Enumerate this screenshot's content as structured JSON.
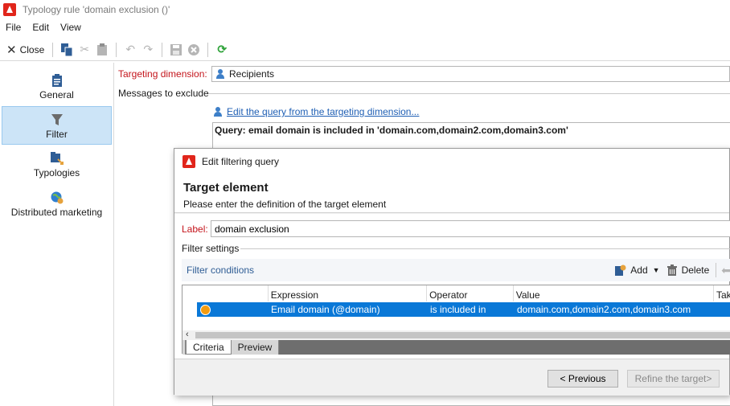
{
  "window": {
    "title": "Typology rule 'domain exclusion ()'"
  },
  "menu": {
    "file": "File",
    "edit": "Edit",
    "view": "View"
  },
  "toolbar": {
    "close_label": "Close",
    "icons": [
      "copy-icon",
      "cut-icon",
      "paste-icon",
      "undo-icon",
      "redo-icon",
      "save-icon",
      "cancel-icon",
      "refresh-icon"
    ]
  },
  "sidebar": {
    "items": [
      {
        "label": "General",
        "icon": "general-icon"
      },
      {
        "label": "Filter",
        "icon": "filter-icon",
        "selected": true
      },
      {
        "label": "Typologies",
        "icon": "typologies-icon"
      },
      {
        "label": "Distributed marketing",
        "icon": "distributed-marketing-icon"
      }
    ]
  },
  "filter_panel": {
    "targeting_label": "Targeting dimension:",
    "targeting_value": "Recipients",
    "messages_label": "Messages to exclude",
    "edit_query_link": "Edit the query from the targeting dimension...",
    "query_text": "Query: email domain is included in 'domain.com,domain2.com,domain3.com'"
  },
  "dialog": {
    "title": "Edit filtering query",
    "heading": "Target element",
    "subheading": "Please enter the definition of the target element",
    "label_caption": "Label:",
    "label_value": "domain exclusion",
    "filter_settings": "Filter settings",
    "filter_conditions": "Filter conditions",
    "add_label": "Add",
    "delete_label": "Delete",
    "columns": [
      "Expression",
      "Operator",
      "Value",
      "Tak"
    ],
    "rows": [
      {
        "expression": "Email domain (@domain)",
        "operator": "is included in",
        "value": "domain.com,domain2.com,domain3.com"
      }
    ],
    "tabs": [
      "Criteria",
      "Preview"
    ],
    "previous_label": "< Previous",
    "next_label": "Refine the target>"
  },
  "colors": {
    "accent": "#0a78d7",
    "required_label": "#c4151c",
    "link": "#1f5fb4",
    "selected_nav": "#cce4f7"
  }
}
